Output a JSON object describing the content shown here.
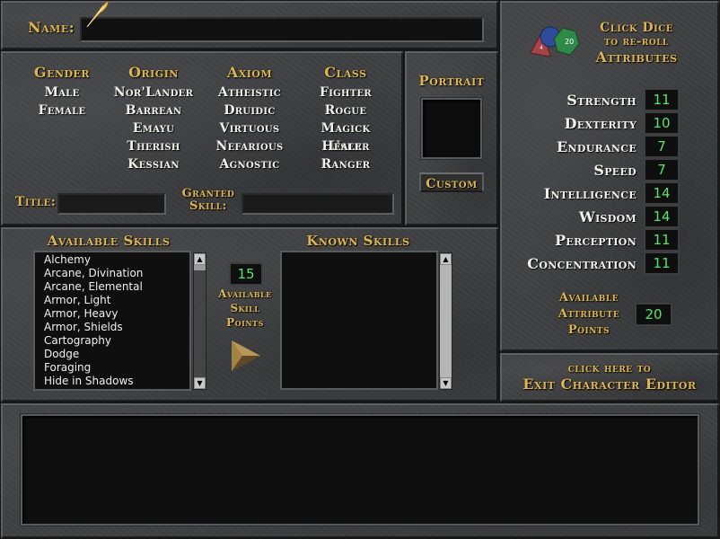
{
  "name_field": {
    "label": "Name:",
    "value": ""
  },
  "columns": [
    {
      "header": "Gender",
      "options": [
        "Male",
        "Female"
      ]
    },
    {
      "header": "Origin",
      "options": [
        "Nor'Lander",
        "Barrean",
        "Emayu",
        "Therish",
        "Kessian"
      ]
    },
    {
      "header": "Axiom",
      "options": [
        "Atheistic",
        "Druidic",
        "Virtuous",
        "Nefarious",
        "Agnostic"
      ]
    },
    {
      "header": "Class",
      "options": [
        "Fighter",
        "Rogue",
        "Magick User",
        "Healer",
        "Ranger"
      ]
    }
  ],
  "title_field": {
    "label": "Title:",
    "value": ""
  },
  "granted_skill": {
    "label_line1": "Granted",
    "label_line2": "Skill:",
    "value": ""
  },
  "portrait": {
    "label": "Portrait",
    "custom_button": "Custom"
  },
  "dice": {
    "line1": "Click Dice",
    "line2": "to re-roll",
    "line3": "Attributes",
    "icon": "dice-icon"
  },
  "attributes": [
    {
      "name": "Strength",
      "value": "11"
    },
    {
      "name": "Dexterity",
      "value": "10"
    },
    {
      "name": "Endurance",
      "value": "7"
    },
    {
      "name": "Speed",
      "value": "7"
    },
    {
      "name": "Intelligence",
      "value": "14"
    },
    {
      "name": "Wisdom",
      "value": "14"
    },
    {
      "name": "Perception",
      "value": "11"
    },
    {
      "name": "Concentration",
      "value": "11"
    }
  ],
  "attribute_points": {
    "line1": "Available",
    "line2": "Attribute",
    "line3": "Points",
    "value": "20"
  },
  "exit": {
    "line1": "click here to",
    "line2": "Exit Character Editor"
  },
  "available_skills": {
    "header": "Available Skills",
    "items": [
      "Alchemy",
      "Arcane, Divination",
      "Arcane, Elemental",
      "Armor, Light",
      "Armor, Heavy",
      "Armor, Shields",
      "Cartography",
      "Dodge",
      "Foraging",
      "Hide in Shadows"
    ]
  },
  "skill_points": {
    "value": "15",
    "line1": "Available",
    "line2": "Skill",
    "line3": "Points"
  },
  "known_skills": {
    "header": "Known Skills",
    "items": []
  },
  "colors": {
    "gold_text": "#d9b65a",
    "value_green": "#5ae36a",
    "stone": "#404142"
  }
}
